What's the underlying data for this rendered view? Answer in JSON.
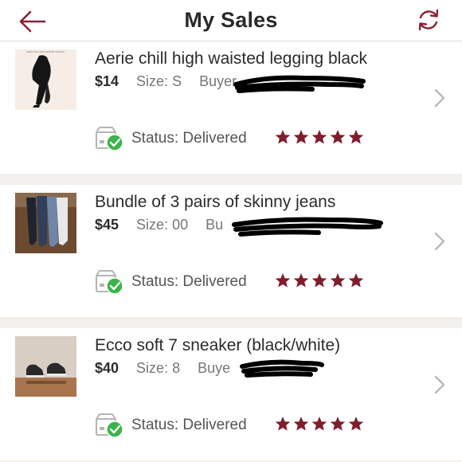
{
  "header": {
    "title": "My Sales"
  },
  "sales": [
    {
      "title": "Aerie chill high waisted legging black",
      "price": "$14",
      "size": "Size: S",
      "buyer": "Buyer",
      "status": "Status: Delivered",
      "rating": 5,
      "thumb_caption": "AERIE CHILL HIGH WAISTED LEGGING"
    },
    {
      "title": "Bundle of 3 pairs of skinny jeans",
      "price": "$45",
      "size": "Size: 00",
      "buyer": "Bu",
      "status": "Status: Delivered",
      "rating": 5
    },
    {
      "title": "Ecco soft 7 sneaker (black/white)",
      "price": "$40",
      "size": "Size: 8",
      "buyer": "Buye",
      "status": "Status: Delivered",
      "rating": 5
    }
  ],
  "icons": {
    "back": "back-arrow-icon",
    "refresh": "refresh-icon",
    "chevron": "chevron-right-icon",
    "delivered": "delivered-box-icon",
    "star": "star-icon"
  },
  "colors": {
    "accent": "#8b2233",
    "star": "#7f1d2c",
    "check": "#3cb44a",
    "chevron": "#b8b8b8"
  }
}
